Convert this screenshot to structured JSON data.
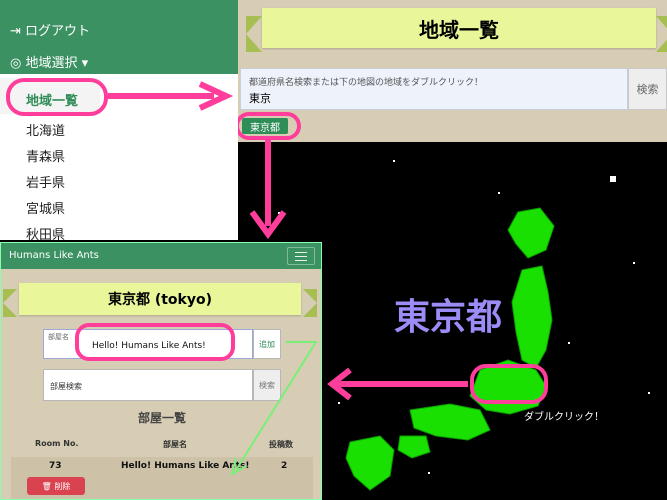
{
  "top_panel": {
    "title": "地域一覧",
    "search_hint": "都道府県名検索または下の地図の地域をダブルクリック！",
    "search_value": "東京",
    "search_button": "検索",
    "tag": "東京都"
  },
  "menu": {
    "header_item_1": "ログアウト",
    "header_item_2": "地域選択",
    "active": "地域一覧",
    "items": [
      "北海道",
      "青森県",
      "岩手県",
      "宮城県",
      "秋田県"
    ]
  },
  "room": {
    "brand": "Humans Like Ants",
    "title": "東京都 (tokyo)",
    "input_label": "部屋名",
    "input_value": "Hello! Humans Like Ants!",
    "add_button": "追加",
    "search_placeholder": "部屋検索",
    "search_button": "検索",
    "list_title": "部屋一覧",
    "columns": [
      "Room No.",
      "部屋名",
      "投稿数"
    ],
    "rows": [
      {
        "no": "73",
        "name": "Hello! Humans Like Ants!",
        "posts": "2",
        "delete": "削除"
      }
    ]
  },
  "map": {
    "pref_name": "東京都",
    "caption": "ダブルクリック！"
  },
  "colors": {
    "green": "#3c9163",
    "ribbon": "#e9f79a",
    "highlight": "#ff3d9b",
    "map_land": "#19e000"
  }
}
